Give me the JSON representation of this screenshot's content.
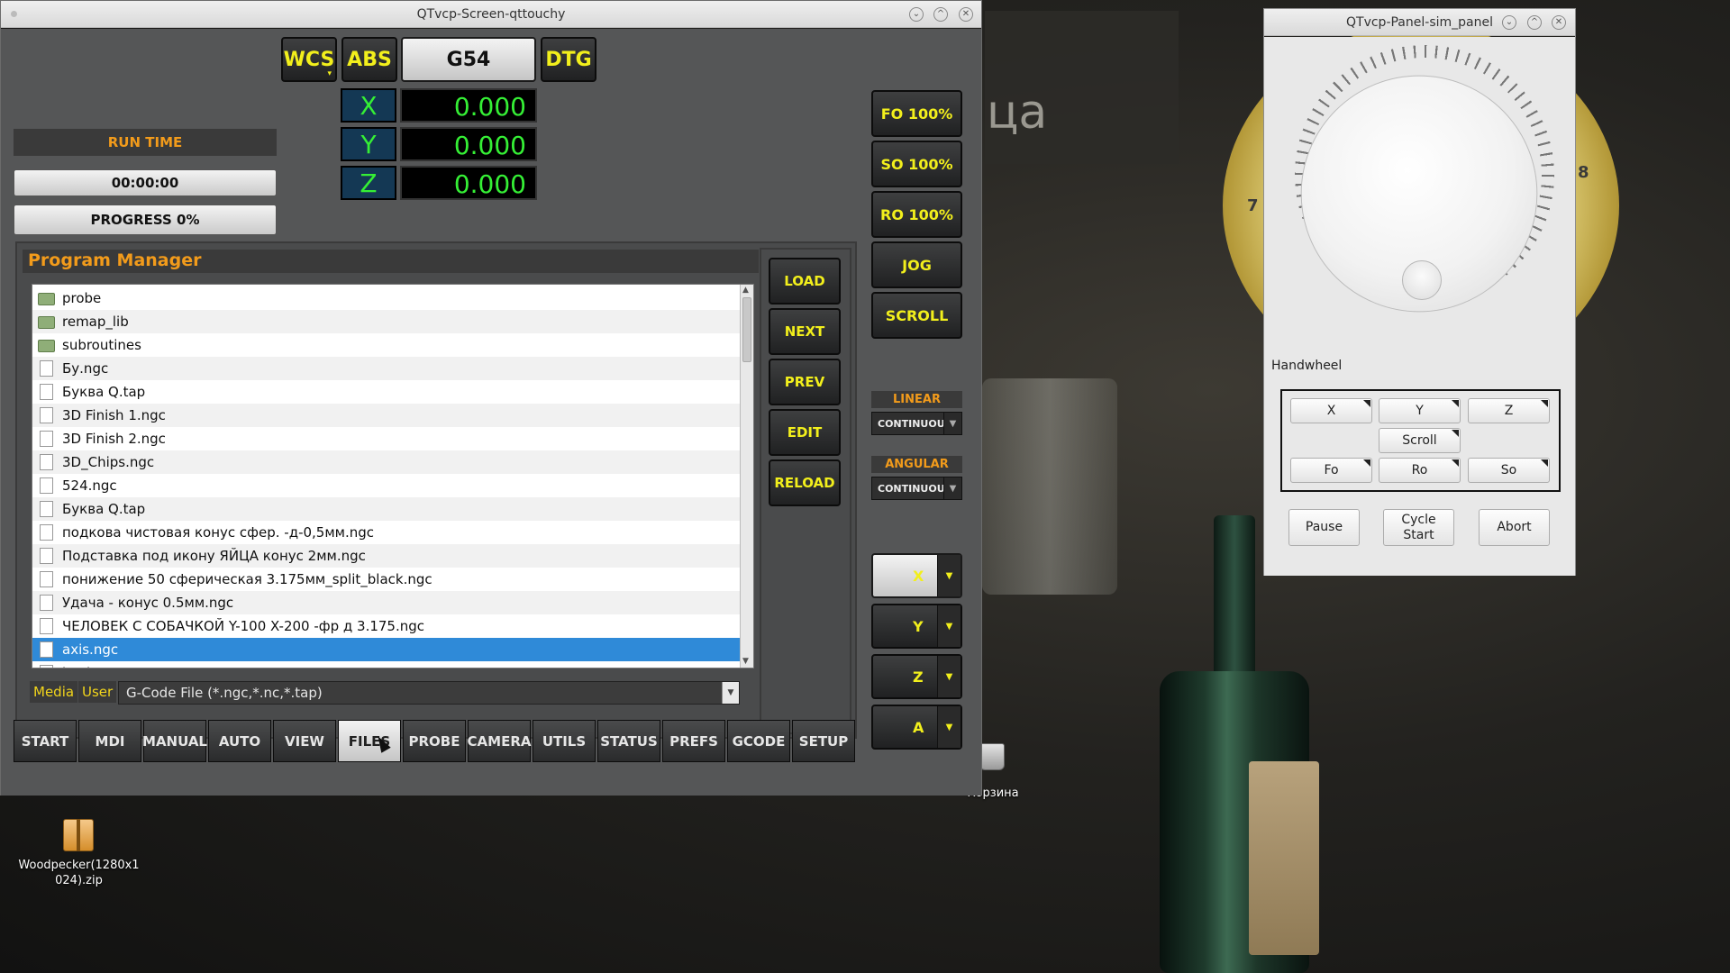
{
  "desktop": {
    "bg_text": "ца",
    "dial_numbers": [
      "7",
      "8"
    ],
    "trash_label": "Корзина",
    "zip_label_line1": "Woodpecker(1280x1",
    "zip_label_line2": "024).zip"
  },
  "main_window": {
    "title": "QTvcp-Screen-qttouchy",
    "controls": [
      "⌄",
      "^",
      "✕"
    ],
    "coord": {
      "wcs_label": "WCS",
      "abs_label": "ABS",
      "g54_label": "G54",
      "dtg_label": "DTG"
    },
    "dro": [
      {
        "axis": "X",
        "value": "0.000"
      },
      {
        "axis": "Y",
        "value": "0.000"
      },
      {
        "axis": "Z",
        "value": "0.000"
      }
    ],
    "run_time_label": "RUN TIME",
    "run_time_value": "00:00:00",
    "progress_label": "PROGRESS 0%",
    "overrides": {
      "fo": "FO 100%",
      "so": "SO 100%",
      "ro": "RO 100%",
      "jog": "JOG",
      "scroll": "SCROLL"
    },
    "linear": {
      "label": "LINEAR",
      "value": "CONTINUOUS"
    },
    "angular": {
      "label": "ANGULAR",
      "value": "CONTINUOUS"
    },
    "axis_select": [
      "X",
      "Y",
      "Z",
      "A"
    ],
    "program_manager": {
      "title": "Program Manager",
      "files": [
        {
          "name": "probe",
          "type": "folder"
        },
        {
          "name": "remap_lib",
          "type": "folder"
        },
        {
          "name": "subroutines",
          "type": "folder"
        },
        {
          "name": " Бу.ngc",
          "type": "file"
        },
        {
          "name": " Буква  Q.tap",
          "type": "file"
        },
        {
          "name": "3D Finish 1.ngc",
          "type": "file"
        },
        {
          "name": "3D Finish 2.ngc",
          "type": "file"
        },
        {
          "name": "3D_Chips.ngc",
          "type": "file"
        },
        {
          "name": "524.ngc",
          "type": "file"
        },
        {
          "name": "Буква Q.tap",
          "type": "file"
        },
        {
          "name": "подкова чистовая конус сфер. -д-0,5мм.ngc",
          "type": "file"
        },
        {
          "name": "Подставка под икону ЯЙЦА конус 2мм.ngc",
          "type": "file"
        },
        {
          "name": "понижение 50 сферическая 3.175мм_split_black.ngc",
          "type": "file"
        },
        {
          "name": "Удача - конус 0.5мм.ngc",
          "type": "file"
        },
        {
          "name": "ЧЕЛОВЕК С СОБАЧКОЙ Y-100 X-200 -фр д 3.175.ngc",
          "type": "file"
        },
        {
          "name": "axis.ngc",
          "type": "file",
          "selected": true
        },
        {
          "name": "back.ngc",
          "type": "file"
        }
      ],
      "side_buttons": [
        "LOAD",
        "NEXT",
        "PREV",
        "EDIT",
        "RELOAD"
      ],
      "media_label": "Media",
      "user_label": "User",
      "filter": "G-Code File (*.ngc,*.nc,*.tap)"
    },
    "tabs": [
      "START",
      "MDI",
      "MANUAL",
      "AUTO",
      "VIEW",
      "FILES",
      "PROBE",
      "CAMERA",
      "UTILS",
      "STATUS",
      "PREFS",
      "GCODE",
      "SETUP"
    ],
    "active_tab": "FILES"
  },
  "sim_panel": {
    "title": "QTvcp-Panel-sim_panel",
    "controls": [
      "⌄",
      "^",
      "✕"
    ],
    "handwheel_label": "Handwheel",
    "axis_buttons": [
      "X",
      "Y",
      "Z"
    ],
    "scroll_label": "Scroll",
    "override_buttons": [
      "Fo",
      "Ro",
      "So"
    ],
    "pause_label": "Pause",
    "cycle_start_line1": "Cycle",
    "cycle_start_line2": "Start",
    "abort_label": "Abort"
  },
  "colors": {
    "accent_orange": "#f29b1b",
    "dro_green": "#35ef35",
    "button_yellow": "#f2ef1c",
    "selection_blue": "#2f8ad8"
  }
}
